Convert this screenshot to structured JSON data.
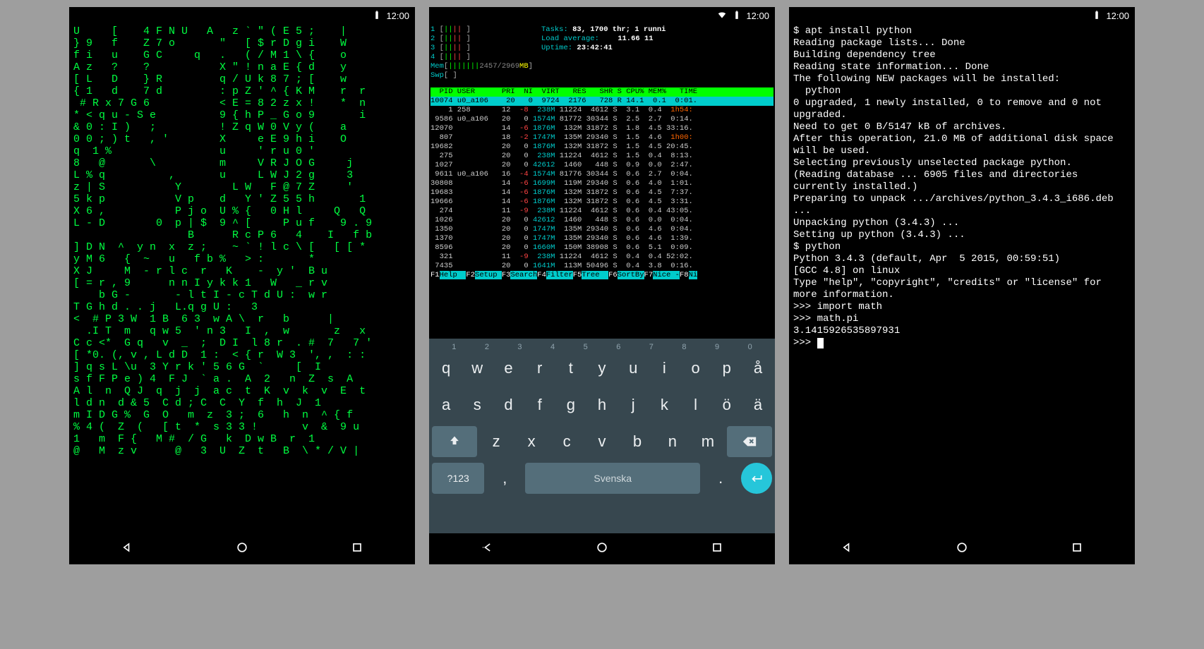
{
  "status": {
    "time": "12:00"
  },
  "matrix": {
    "lines": [
      "U     [    4 F N U   A   z ` \" ( E 5 ;    |    ",
      "} 9   f    Z 7 o       \"   [ $ r D g i    W    ",
      "f i   u    G C     q   .   ( / M 1 \\ {    o    ",
      "A z   ?    ?           X \" ! n a E { d    y    ",
      "[ L   D    } R         q / U k 8 7 ; [    w    ",
      "{ 1   d    7 d         : p Z ' ^ { K M    r  r ",
      " # R x 7 G 6           < E = 8 2 z x !    *  n ",
      "* < q u - S e          9 { h P _ G o 9       i ",
      "& 0 : I )   ;          ! Z q W 0 V y (    a   ",
      "0 0 ; ) t   , '        X     e E 9 h i    O   ",
      "q  1 %                 u     ' r u 0 '         ",
      "8   @       \\          m     V R J O G     j  ",
      "L % q          ,       u     L W J 2 g     3  ",
      "z | S           Y        L W   F @ 7 Z     ' ",
      "5 k p           V p    d   Y ' Z 5 5 h       1 ",
      "X 6 ,           P j o  U % {   0 H l     Q   Q ",
      "L - D        0  p | $  9 ^ [     P u f    9 . 9",
      "                  B      R c P 6   4    I   f b",
      "] D N  ^  y n  x  z ;    ~ ` ! l c \\ [   [ [ *",
      "y M 6   {  ~   u   f b %   > :       *       ",
      "X J     M  - r l c  r   K    -  y '  B u",
      "[ = r , 9      n n I y k k 1   W   _ r v",
      "    b G -       - l t I - c T d U :  w r",
      "T G h d . . j   L.q g U :   3",
      "<  # P 3 W  1 B  6 3  w A \\  r   b      | ",
      "  .I T  m   q w 5  ' n 3   I  ,  w       z   x",
      "C c <*  G q   v  _  ;  D I  l 8 r  . #  7   7 '",
      "[ *0. (, v , L d D  1 :  < { r  W 3  ', ,  : :",
      "] q s L \\u  3 Y r k ' 5 6 G  `     [  I",
      "s f F P e ) 4  F J  ` a .  A  2   n  Z  s  A",
      "A l  n  Q J  q  j  j  a c  t  K  v  k  v  E  t",
      "l d n  d & 5  C d ; C  C  Y  f  h  J  1",
      "m I D G %  G  O   m  z  3 ;  6   h  n  ^ { f",
      "% 4 (  Z  (   [ t  *  s 3 3 !       v  &  9 u",
      "1   m  F {   M #  / G   k  D w B  r  1   ",
      "@   M  z v      @   3  U  Z  t   B  \\ * / V |"
    ]
  },
  "htop": {
    "cpus": [
      "1",
      "2",
      "3",
      "4"
    ],
    "mem_used": "2457",
    "mem_total": "2969",
    "mem_unit": "MB",
    "tasks_label": "Tasks:",
    "tasks_value": "83, 1700 thr; 1 runni",
    "load_label": "Load average:",
    "load_value": "11.66 11",
    "uptime_label": "Uptime:",
    "uptime_value": "23:42:41",
    "columns": "  PID USER      PRI  NI  VIRT   RES   SHR S CPU% MEM%   TIME",
    "highlight_row": "10074 u0_a106    20   0  9724  2176   728 R 14.1  0.1  0:01.",
    "rows": [
      {
        "pid": "    1",
        "user": "258",
        "pri": "12",
        "ni": "-8",
        "virt": "238M",
        "res": "11224",
        "shr": "4612",
        "s": "S",
        "cpu": "3.1",
        "mem": "0.4",
        "time": "1h54:",
        "nineg": true,
        "tred": true
      },
      {
        "pid": " 9586",
        "user": "u0_a106",
        "pri": "20",
        "ni": "0",
        "virt": "1574M",
        "res": "81772",
        "shr": "30344",
        "s": "S",
        "cpu": "2.5",
        "mem": "2.7",
        "time": "0:14.",
        "nineg": false,
        "tred": false
      },
      {
        "pid": "12070",
        "user": "",
        "pri": "14",
        "ni": "-6",
        "virt": "1876M",
        "res": "132M",
        "shr": "31872",
        "s": "S",
        "cpu": "1.8",
        "mem": "4.5",
        "time": "33:16.",
        "nineg": true,
        "tred": false
      },
      {
        "pid": "  807",
        "user": "",
        "pri": "18",
        "ni": "-2",
        "virt": "1747M",
        "res": "135M",
        "shr": "29340",
        "s": "S",
        "cpu": "1.5",
        "mem": "4.6",
        "time": "1h00:",
        "nineg": true,
        "tred": true
      },
      {
        "pid": "19682",
        "user": "",
        "pri": "20",
        "ni": "0",
        "virt": "1876M",
        "res": "132M",
        "shr": "31872",
        "s": "S",
        "cpu": "1.5",
        "mem": "4.5",
        "time": "20:45.",
        "nineg": false,
        "tred": false
      },
      {
        "pid": "  275",
        "user": "",
        "pri": "20",
        "ni": "0",
        "virt": "238M",
        "res": "11224",
        "shr": "4612",
        "s": "S",
        "cpu": "1.5",
        "mem": "0.4",
        "time": "8:13.",
        "nineg": false,
        "tred": false
      },
      {
        "pid": " 1027",
        "user": "",
        "pri": "20",
        "ni": "0",
        "virt": "42612",
        "res": "1460",
        "shr": "448",
        "s": "S",
        "cpu": "0.9",
        "mem": "0.0",
        "time": "2:47.",
        "nineg": false,
        "tred": false
      },
      {
        "pid": " 9611",
        "user": "u0_a106",
        "pri": "16",
        "ni": "-4",
        "virt": "1574M",
        "res": "81776",
        "shr": "30344",
        "s": "S",
        "cpu": "0.6",
        "mem": "2.7",
        "time": "0:04.",
        "nineg": true,
        "tred": false
      },
      {
        "pid": "30808",
        "user": "",
        "pri": "14",
        "ni": "-6",
        "virt": "1699M",
        "res": "119M",
        "shr": "29340",
        "s": "S",
        "cpu": "0.6",
        "mem": "4.0",
        "time": "1:01.",
        "nineg": true,
        "tred": false
      },
      {
        "pid": "19683",
        "user": "",
        "pri": "14",
        "ni": "-6",
        "virt": "1876M",
        "res": "132M",
        "shr": "31872",
        "s": "S",
        "cpu": "0.6",
        "mem": "4.5",
        "time": "7:37.",
        "nineg": true,
        "tred": false
      },
      {
        "pid": "19666",
        "user": "",
        "pri": "14",
        "ni": "-6",
        "virt": "1876M",
        "res": "132M",
        "shr": "31872",
        "s": "S",
        "cpu": "0.6",
        "mem": "4.5",
        "time": "3:31.",
        "nineg": true,
        "tred": false
      },
      {
        "pid": "  274",
        "user": "",
        "pri": "11",
        "ni": "-9",
        "virt": "238M",
        "res": "11224",
        "shr": "4612",
        "s": "S",
        "cpu": "0.6",
        "mem": "0.4",
        "time": "43:05.",
        "nineg": true,
        "tred": false
      },
      {
        "pid": " 1026",
        "user": "",
        "pri": "20",
        "ni": "0",
        "virt": "42612",
        "res": "1460",
        "shr": "448",
        "s": "S",
        "cpu": "0.6",
        "mem": "0.0",
        "time": "0:04.",
        "nineg": false,
        "tred": false
      },
      {
        "pid": " 1350",
        "user": "",
        "pri": "20",
        "ni": "0",
        "virt": "1747M",
        "res": "135M",
        "shr": "29340",
        "s": "S",
        "cpu": "0.6",
        "mem": "4.6",
        "time": "0:04.",
        "nineg": false,
        "tred": false
      },
      {
        "pid": " 1370",
        "user": "",
        "pri": "20",
        "ni": "0",
        "virt": "1747M",
        "res": "135M",
        "shr": "29340",
        "s": "S",
        "cpu": "0.6",
        "mem": "4.6",
        "time": "1:39.",
        "nineg": false,
        "tred": false
      },
      {
        "pid": " 8596",
        "user": "",
        "pri": "20",
        "ni": "0",
        "virt": "1660M",
        "res": "150M",
        "shr": "38908",
        "s": "S",
        "cpu": "0.6",
        "mem": "5.1",
        "time": "0:09.",
        "nineg": false,
        "tred": false
      },
      {
        "pid": "  321",
        "user": "",
        "pri": "11",
        "ni": "-9",
        "virt": "238M",
        "res": "11224",
        "shr": "4612",
        "s": "S",
        "cpu": "0.4",
        "mem": "0.4",
        "time": "52:02.",
        "nineg": true,
        "tred": false
      },
      {
        "pid": " 7435",
        "user": "",
        "pri": "20",
        "ni": "0",
        "virt": "1641M",
        "res": "113M",
        "shr": "50496",
        "s": "S",
        "cpu": "0.4",
        "mem": "3.8",
        "time": "0:16.",
        "nineg": false,
        "tred": false
      }
    ],
    "fkeys": [
      {
        "f": "F1",
        "l": "Help  "
      },
      {
        "f": "F2",
        "l": "Setup "
      },
      {
        "f": "F3",
        "l": "Search"
      },
      {
        "f": "F4",
        "l": "Filter"
      },
      {
        "f": "F5",
        "l": "Tree  "
      },
      {
        "f": "F6",
        "l": "SortBy"
      },
      {
        "f": "F7",
        "l": "Nice -"
      },
      {
        "f": "F8",
        "l": "Ni"
      }
    ]
  },
  "keyboard": {
    "numbers": [
      "1",
      "2",
      "3",
      "4",
      "5",
      "6",
      "7",
      "8",
      "9",
      "0"
    ],
    "row1": [
      "q",
      "w",
      "e",
      "r",
      "t",
      "y",
      "u",
      "i",
      "o",
      "p",
      "å"
    ],
    "row2": [
      "a",
      "s",
      "d",
      "f",
      "g",
      "h",
      "j",
      "k",
      "l",
      "ö",
      "ä"
    ],
    "row3": [
      "z",
      "x",
      "c",
      "v",
      "b",
      "n",
      "m"
    ],
    "symbols_key": "?123",
    "comma": ",",
    "period": ".",
    "space_label": "Svenska"
  },
  "pyterm": {
    "lines": [
      "$ apt install python",
      "Reading package lists... Done",
      "Building dependency tree",
      "Reading state information... Done",
      "The following NEW packages will be installed:",
      "  python",
      "0 upgraded, 1 newly installed, 0 to remove and 0 not upgraded.",
      "Need to get 0 B/5147 kB of archives.",
      "After this operation, 21.0 MB of additional disk space will be used.",
      "Selecting previously unselected package python.",
      "(Reading database ... 6905 files and directories currently installed.)",
      "Preparing to unpack .../archives/python_3.4.3_i686.deb ...",
      "Unpacking python (3.4.3) ...",
      "Setting up python (3.4.3) ...",
      "$ python",
      "Python 3.4.3 (default, Apr  5 2015, 00:59:51)",
      "[GCC 4.8] on linux",
      "Type \"help\", \"copyright\", \"credits\" or \"license\" for more information.",
      ">>> import math",
      ">>> math.pi",
      "3.1415926535897931",
      ">>> "
    ]
  }
}
